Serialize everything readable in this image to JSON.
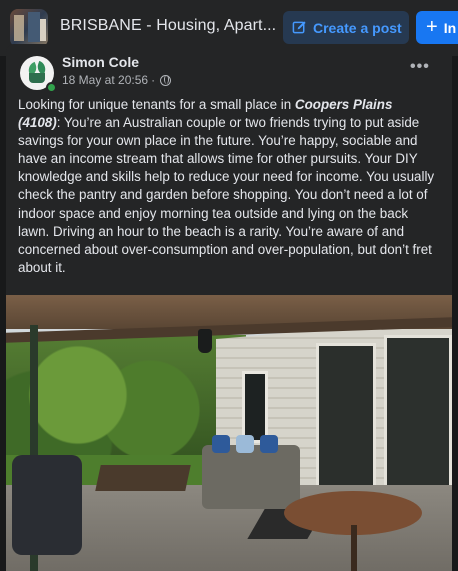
{
  "group": {
    "name": "BRISBANE - Housing, Apart...",
    "create_post_label": "Create a post",
    "invite_label": "In"
  },
  "post": {
    "author": "Simon Cole",
    "timestamp": "18 May at 20:56",
    "dot": "·",
    "privacy_icon": "globe-icon",
    "more_label": "•••",
    "text_before": "Looking for unique tenants for a small place in ",
    "location": "Coopers Plains (4108)",
    "text_after": ": You’re an Australian couple or two friends trying to put aside savings for your own place in the future. You’re happy, sociable and have an income stream that allows time for other pursuits. Your DIY knowledge and skills help to reduce your need for income. You usually check the pantry and garden before shopping. You don’t need a lot of indoor space and enjoy morning tea outside and lying on the back lawn. Driving an hour to the beach is a rarity. You’re aware of and concerned about over-consumption and over-population, but don’t fret about it."
  },
  "colors": {
    "background": "#18191a",
    "card": "#242526",
    "accent": "#1877f2",
    "accent_soft": "#263951",
    "text_primary": "#e4e6eb",
    "text_secondary": "#b0b3b8",
    "online": "#31a24c"
  }
}
